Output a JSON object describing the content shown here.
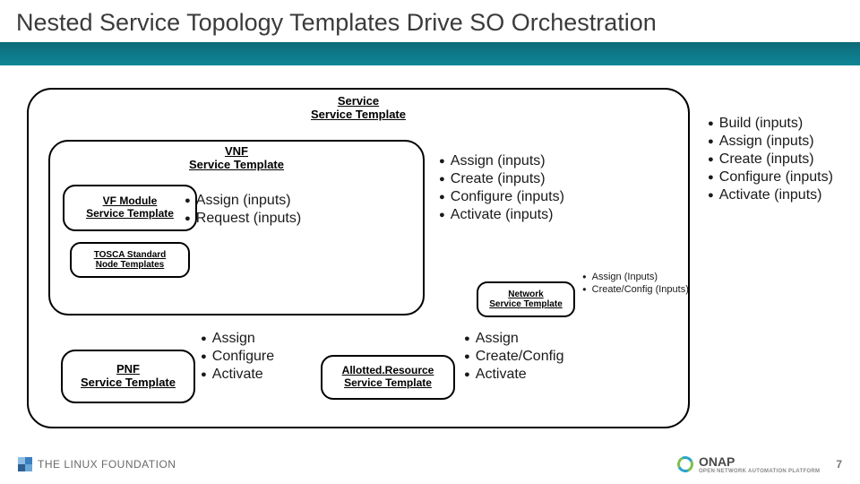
{
  "title": "Nested Service Topology Templates Drive SO Orchestration",
  "boxes": {
    "service": "Service\nService Template",
    "vnf": "VNF\nService Template",
    "vfmodule": "VF Module\nService Template",
    "tosca": "TOSCA Standard\nNode Templates",
    "pnf": "PNF\nService Template",
    "allotted": "Allotted.Resource\nService Template",
    "network": "Network\nService Template"
  },
  "lists": {
    "vfmodule": [
      "Assign (inputs)",
      "Request (inputs)"
    ],
    "vnf": [
      "Assign (inputs)",
      "Create (inputs)",
      "Configure (inputs)",
      "Activate (inputs)"
    ],
    "service": [
      "Build (inputs)",
      "Assign (inputs)",
      "Create (inputs)",
      "Configure (inputs)",
      "Activate (inputs)"
    ],
    "pnf": [
      "Assign",
      "Configure",
      "Activate"
    ],
    "allotted": [
      "Assign",
      "Create/Config",
      "Activate"
    ],
    "network": [
      "Assign (Inputs)",
      "Create/Config (Inputs)"
    ]
  },
  "footer": {
    "linux": "THE LINUX FOUNDATION",
    "onap": "ONAP",
    "onap_sub": "OPEN NETWORK AUTOMATION PLATFORM",
    "page": "7"
  }
}
